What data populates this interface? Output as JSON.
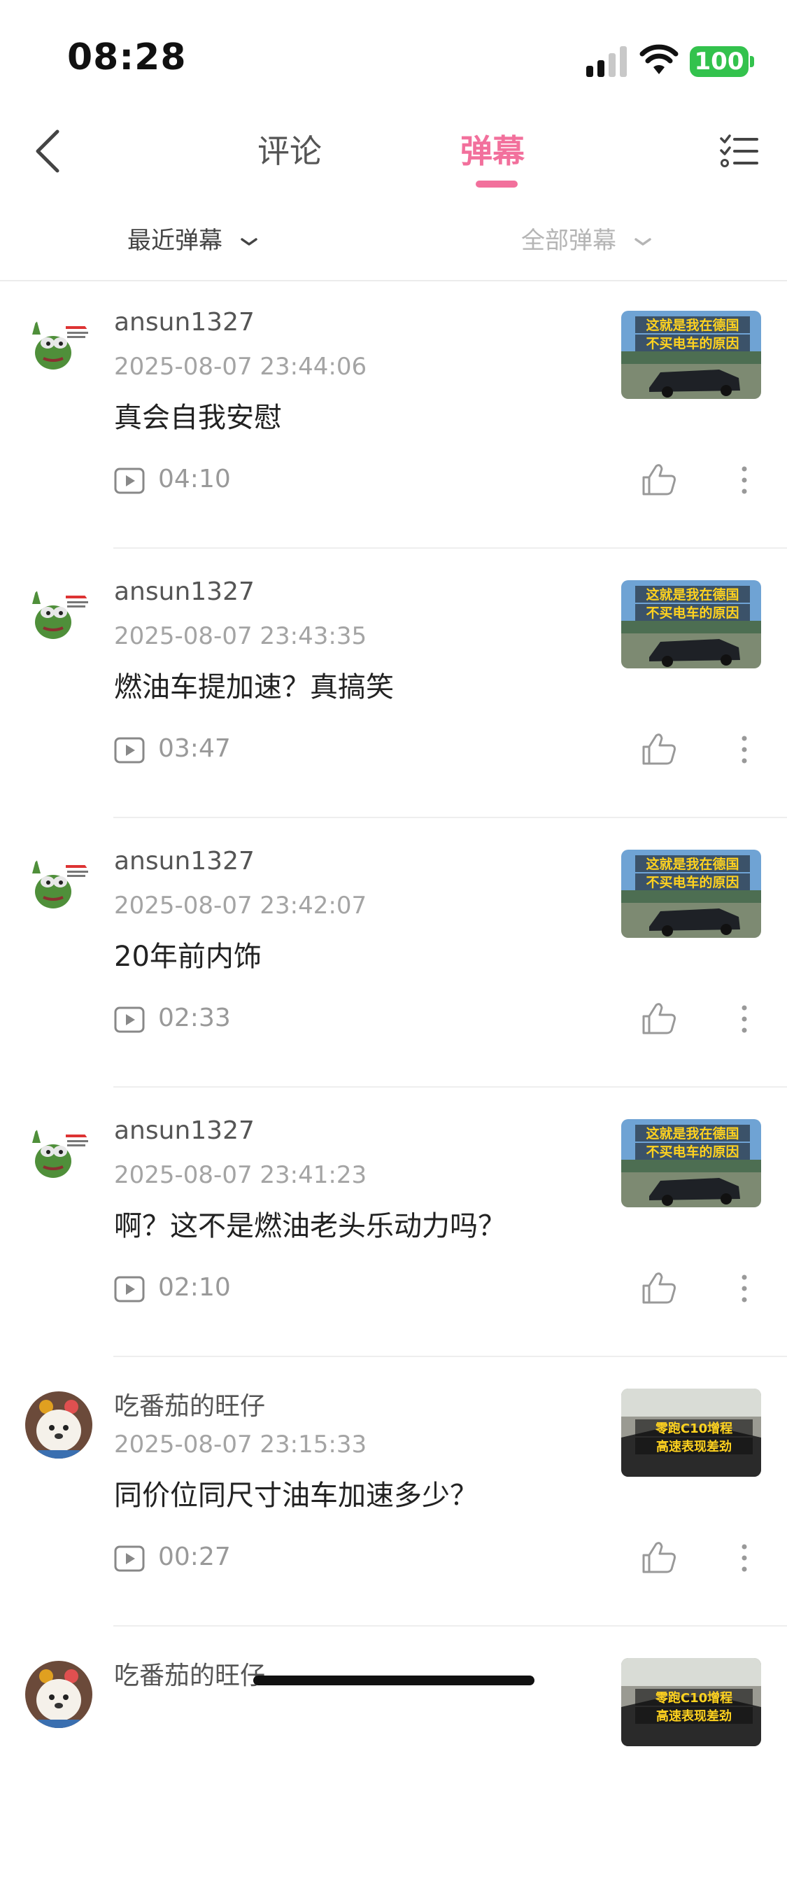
{
  "status_bar": {
    "time": "08:28",
    "battery": "100"
  },
  "header": {
    "tabs": [
      {
        "label": "评论"
      },
      {
        "label": "弹幕"
      }
    ],
    "active_tab": "弹幕"
  },
  "filters": {
    "left": "最近弹幕",
    "right": "全部弹幕"
  },
  "thumb_captions": {
    "germany": [
      "这就是我在德国",
      "不买电车的原因"
    ],
    "zeekr": [
      "零跑C10增程",
      "高速表现差劲"
    ]
  },
  "comments": [
    {
      "username": "ansun1327",
      "timestamp": "2025-08-07 23:44:06",
      "text": "真会自我安慰",
      "play_time": "04:10",
      "avatar": "pepe",
      "thumb": "germany"
    },
    {
      "username": "ansun1327",
      "timestamp": "2025-08-07 23:43:35",
      "text": "燃油车提加速？真搞笑",
      "play_time": "03:47",
      "avatar": "pepe",
      "thumb": "germany"
    },
    {
      "username": "ansun1327",
      "timestamp": "2025-08-07 23:42:07",
      "text": "20年前内饰",
      "play_time": "02:33",
      "avatar": "pepe",
      "thumb": "germany"
    },
    {
      "username": "ansun1327",
      "timestamp": "2025-08-07 23:41:23",
      "text": "啊？这不是燃油老头乐动力吗？",
      "play_time": "02:10",
      "avatar": "pepe",
      "thumb": "germany"
    },
    {
      "username": "吃番茄的旺仔",
      "timestamp": "2025-08-07 23:15:33",
      "text": "同价位同尺寸油车加速多少？",
      "play_time": "00:27",
      "avatar": "dog",
      "thumb": "zeekr"
    },
    {
      "username": "吃番茄的旺仔",
      "timestamp": "",
      "text": "",
      "play_time": "",
      "avatar": "dog",
      "thumb": "zeekr"
    }
  ],
  "colors": {
    "accent": "#f2709c",
    "battery": "#33c24d",
    "muted": "#a4a4a4"
  }
}
